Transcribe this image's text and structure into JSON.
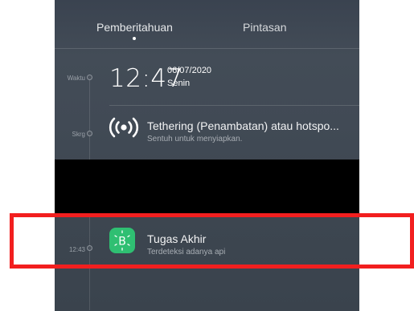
{
  "tabs": [
    {
      "label": "Pemberitahuan",
      "active": true
    },
    {
      "label": "Pintasan",
      "active": false
    }
  ],
  "timeline": {
    "time_label": "Waktu",
    "now_label": "Skrg",
    "notif_time": "12:43"
  },
  "clock": {
    "time": "12:47",
    "date": "06/07/2020",
    "day": "Senin"
  },
  "notifications": [
    {
      "icon": "tethering-icon",
      "title": "Tethering (Penambatan) atau hotspo...",
      "subtitle": "Sentuh untuk menyiapkan."
    },
    {
      "icon": "bluetooth-app-icon",
      "app_letter": "B",
      "title": "Tugas Akhir",
      "subtitle": "Terdeteksi adanya api"
    }
  ],
  "colors": {
    "panel_bg": "#414a55",
    "app_icon_bg": "#2fbf72",
    "highlight": "#f21f1f",
    "redaction": "#000000"
  }
}
